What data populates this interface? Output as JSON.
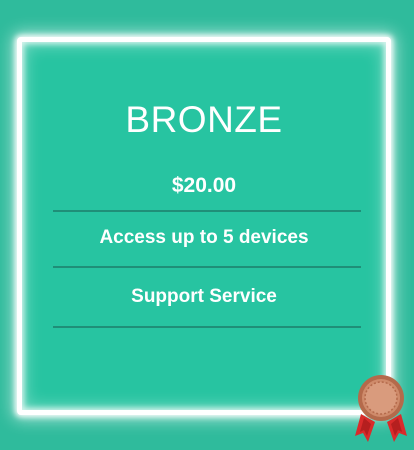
{
  "plan": {
    "tier_name": "BRONZE",
    "price": "$20.00",
    "features": [
      "Access up to 5 devices",
      "Support Service"
    ]
  },
  "icons": {
    "badge": "bronze-medal-icon"
  },
  "colors": {
    "background": "#2fbb9c",
    "card_fill": "#27c4a1",
    "divider": "#1f8f78",
    "text": "#ffffff",
    "medal_bronze": "#c27a5a",
    "ribbon_red": "#d92b2b"
  }
}
